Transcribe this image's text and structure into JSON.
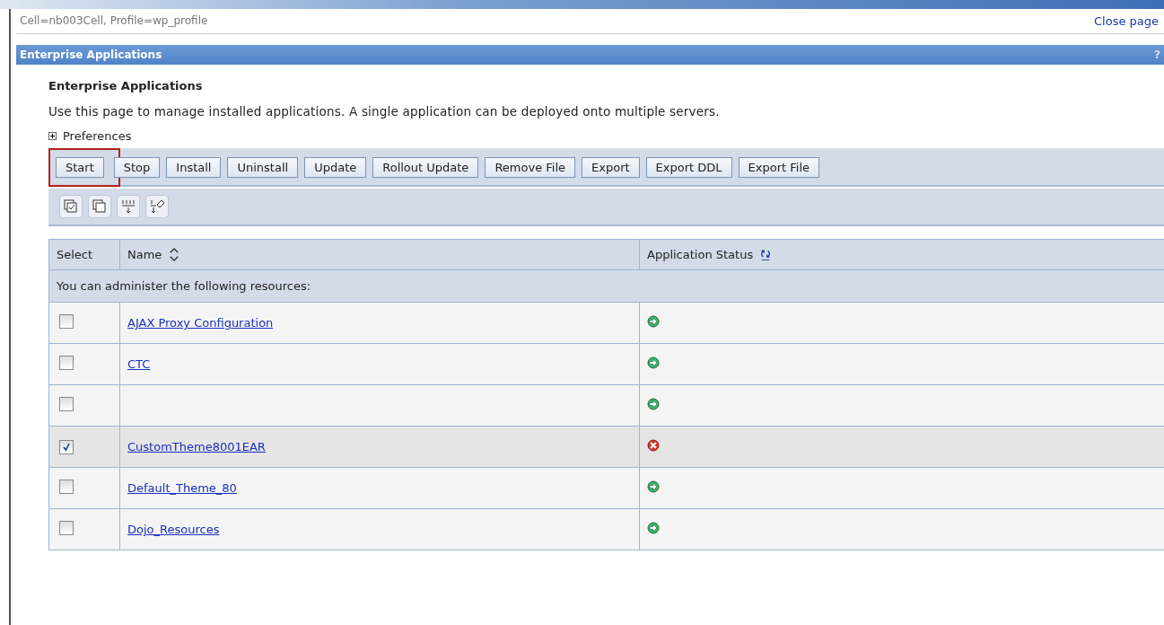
{
  "breadcrumb": "Cell=nb003Cell, Profile=wp_profile",
  "close_link": "Close page",
  "panel": {
    "title": "Enterprise Applications",
    "help": "?"
  },
  "heading": "Enterprise Applications",
  "description": "Use this page to manage installed applications. A single application can be deployed onto multiple servers.",
  "preferences": {
    "label": "Preferences",
    "expanded": false
  },
  "buttons": [
    {
      "label": "Start",
      "highlighted": true
    },
    {
      "label": "Stop",
      "highlighted": false
    },
    {
      "label": "Install",
      "highlighted": false
    },
    {
      "label": "Uninstall",
      "highlighted": false
    },
    {
      "label": "Update",
      "highlighted": false
    },
    {
      "label": "Rollout Update",
      "highlighted": false
    },
    {
      "label": "Remove File",
      "highlighted": false
    },
    {
      "label": "Export",
      "highlighted": false
    },
    {
      "label": "Export DDL",
      "highlighted": false
    },
    {
      "label": "Export File",
      "highlighted": false
    }
  ],
  "tools": [
    {
      "kind": "select-all"
    },
    {
      "kind": "deselect-all"
    },
    {
      "kind": "show-filter"
    },
    {
      "kind": "clear-filter"
    }
  ],
  "table": {
    "columns": [
      "Select",
      "Name",
      "Application Status"
    ],
    "group_row": "You can administer the following resources:",
    "rows": [
      {
        "name": "AJAX Proxy Configuration",
        "checked": false,
        "kind": "running"
      },
      {
        "name": "CTC",
        "checked": false,
        "kind": "running"
      },
      {
        "checked": false,
        "kind": "running"
      },
      {
        "name": "CustomTheme8001EAR",
        "checked": true,
        "kind": "stopped"
      },
      {
        "name": "Default_Theme_80",
        "checked": false,
        "kind": "running"
      },
      {
        "name": "Dojo_Resources",
        "checked": false,
        "kind": "running"
      }
    ]
  }
}
